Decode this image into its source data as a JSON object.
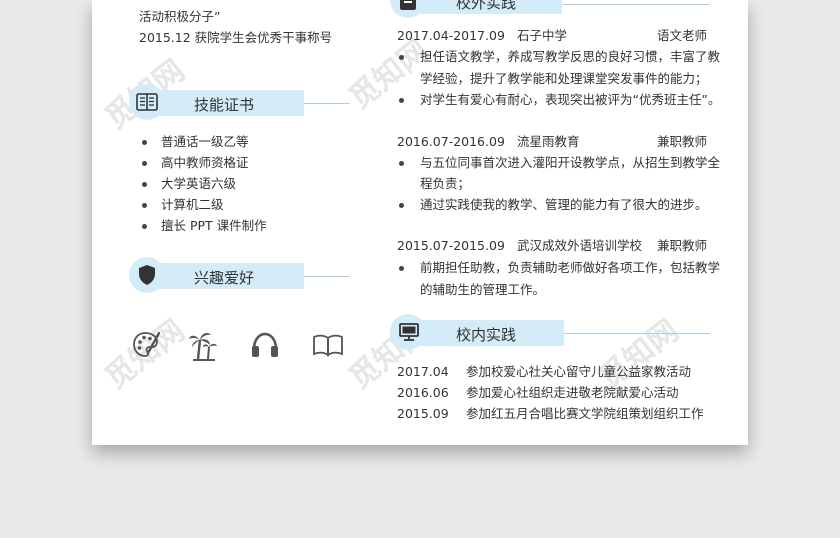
{
  "watermark": "觅知网",
  "left": {
    "award_cont": "活动积极分子”",
    "award_2": "2015.12 获院学生会优秀干事称号",
    "skills": {
      "title": "技能证书",
      "items": [
        "普通话一级乙等",
        "高中教师资格证",
        "大学英语六级",
        "计算机二级",
        "擅长 PPT 课件制作"
      ]
    },
    "hobbies": {
      "title": "兴趣爱好",
      "icons": [
        "palette-icon",
        "palm-tree-icon",
        "headphones-icon",
        "book-icon"
      ]
    }
  },
  "right": {
    "external": {
      "title": "校外实践",
      "jobs": [
        {
          "date": "2017.04-2017.09",
          "org": "石子中学",
          "role": "语文老师",
          "bullets": [
            [
              "担任语文教学，养成写教学反思的良好习惯，丰富了教",
              "学经验，提升了教学能和处理课堂突发事件的能力；"
            ],
            [
              "对学生有爱心有耐心，表现突出被评为“优秀班主任”。"
            ]
          ]
        },
        {
          "date": "2016.07-2016.09",
          "org": "流星雨教育",
          "role": "兼职教师",
          "bullets": [
            [
              "与五位同事首次进入灌阳开设教学点，从招生到教学全",
              "程负责；"
            ],
            [
              "通过实践使我的教学、管理的能力有了很大的进步。"
            ]
          ]
        },
        {
          "date": "2015.07-2015.09",
          "org": "武汉成效外语培训学校",
          "role": "兼职教师",
          "bullets": [
            [
              "前期担任助教，负责辅助老师做好各项工作，包括教学",
              "的辅助生的管理工作。"
            ]
          ]
        }
      ]
    },
    "internal": {
      "title": "校内实践",
      "rows": [
        {
          "date": "2017.04",
          "text": "参加校爱心社关心留守儿童公益家教活动"
        },
        {
          "date": "2016.06",
          "text": "参加爱心社组织走进敬老院献爱心活动"
        },
        {
          "date": "2015.09",
          "text": "参加红五月合唱比赛文学院组策划组织工作"
        }
      ]
    }
  }
}
